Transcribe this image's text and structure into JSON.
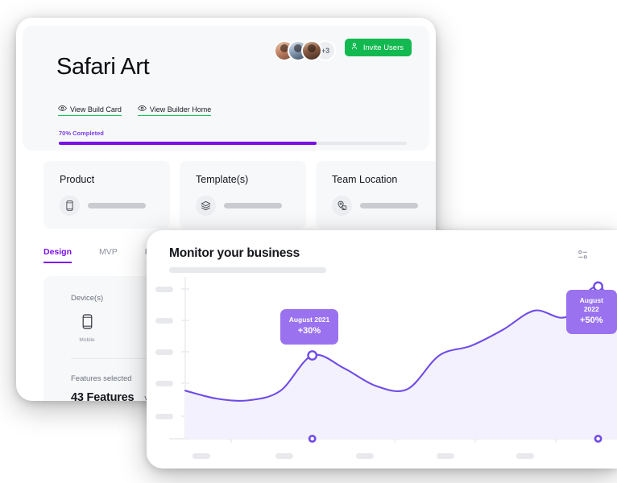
{
  "dashboard": {
    "title": "Safari Art",
    "avatars": {
      "extra_count": "+3",
      "count": 3
    },
    "invite_button": {
      "label": "Invite Users",
      "icon": "person-add-icon",
      "color": "#12b950"
    },
    "links": [
      {
        "label": "View Build Card",
        "icon": "eye-icon"
      },
      {
        "label": "View Builder Home",
        "icon": "eye-icon"
      }
    ],
    "progress": {
      "label": "70% Completed",
      "percent": 70,
      "fill_width_pct": 74,
      "color": "#7a0fe8"
    },
    "summary_cards": [
      {
        "title": "Product",
        "icon": "mobile-phone-icon"
      },
      {
        "title": "Template(s)",
        "icon": "layers-icon"
      },
      {
        "title": "Team Location",
        "icon": "map-pin-icon"
      }
    ],
    "tabs": [
      {
        "label": "Design",
        "active": true
      },
      {
        "label": "MVP",
        "active": false
      },
      {
        "label": "Full Bu",
        "active": false
      }
    ],
    "detail": {
      "devices_label": "Device(s)",
      "device_name": "Mobile",
      "device_icon": "mobile-phone-icon",
      "features_label": "Features selected",
      "features_count": "43 Features",
      "view_label": "View"
    }
  },
  "chart_panel": {
    "title": "Monitor your business",
    "menu_icon": "sliders-icon"
  },
  "chart_data": {
    "type": "area",
    "title": "Monitor your business",
    "xlabel": "",
    "ylabel": "",
    "grid": false,
    "legend": "none",
    "line_color": "#6f4be8",
    "fill_color": "#f3f1fe",
    "x": [
      0,
      1,
      2,
      3,
      4,
      5,
      6,
      7,
      8,
      9,
      10,
      11,
      12,
      13,
      14
    ],
    "values": [
      30,
      25,
      24,
      30,
      52,
      44,
      33,
      31,
      52,
      58,
      68,
      80,
      76,
      95,
      66
    ],
    "categories": [
      "",
      "",
      "",
      "",
      ""
    ],
    "ylim": [
      0,
      100
    ],
    "annotations": [
      {
        "label": "August 2021",
        "value": "+30%",
        "x_index": 4,
        "color": "#9a72f0"
      },
      {
        "label": "August 2022",
        "value": "+50%",
        "x_index": 13,
        "color": "#9a72f0"
      }
    ],
    "markers": [
      {
        "x_index": 4,
        "label": "August 2021"
      },
      {
        "x_index": 13,
        "label": "August 2022"
      }
    ]
  }
}
